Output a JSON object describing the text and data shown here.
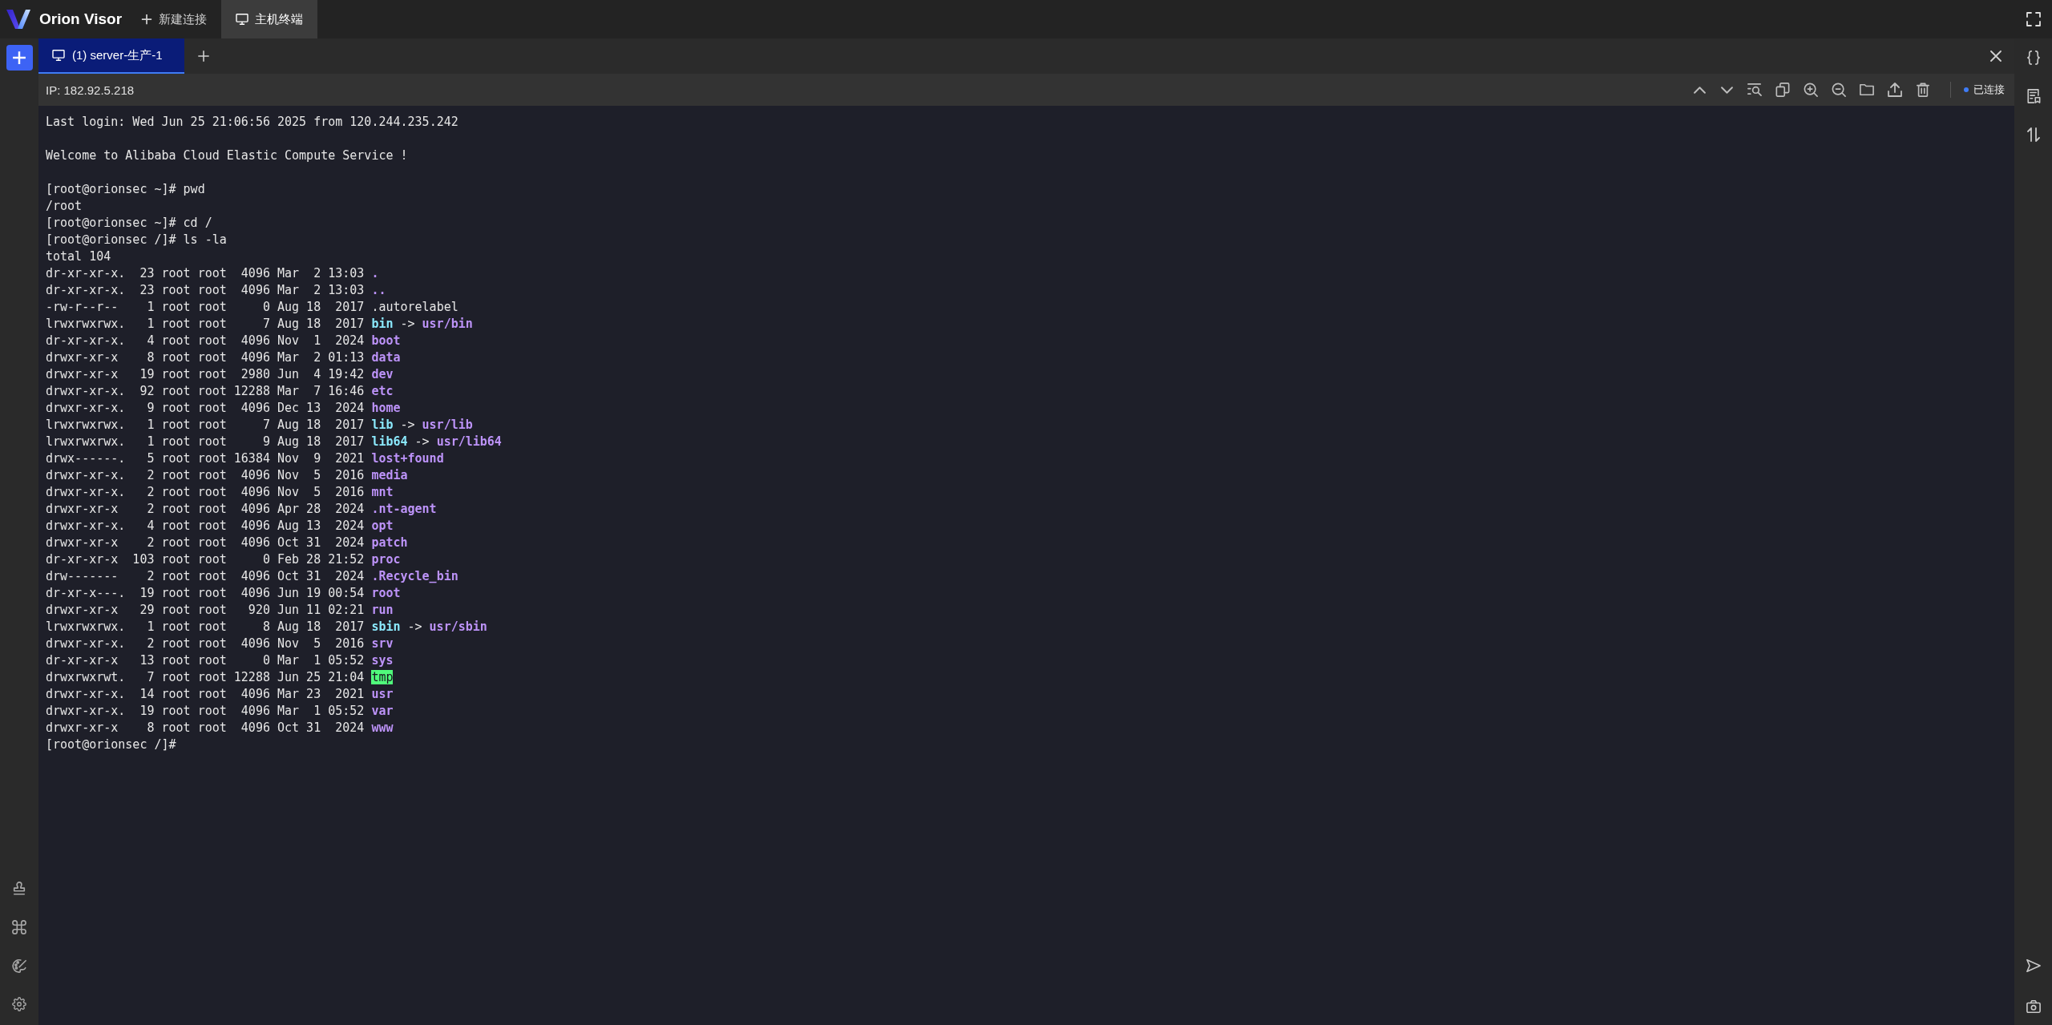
{
  "header": {
    "app_name": "Orion Visor",
    "nav_tabs": [
      {
        "label": "新建连接",
        "kind": "action",
        "selected": false
      },
      {
        "label": "主机终端",
        "kind": "page",
        "selected": true
      }
    ]
  },
  "session_tabs": [
    {
      "label": "(1) server-生产-1",
      "selected": true
    }
  ],
  "host_bar": {
    "ip": "IP: 182.92.5.218",
    "connected": true,
    "status": "已连接"
  },
  "terminal": {
    "lines": [
      {
        "kind": "text",
        "text": "Last login: Wed Jun 25 21:06:56 2025 from 120.244.235.242"
      },
      {
        "kind": "blank"
      },
      {
        "kind": "text",
        "text": "Welcome to Alibaba Cloud Elastic Compute Service !"
      },
      {
        "kind": "blank"
      },
      {
        "kind": "text",
        "text": "[root@orionsec ~]# pwd"
      },
      {
        "kind": "text",
        "text": "/root"
      },
      {
        "kind": "text",
        "text": "[root@orionsec ~]# cd /"
      },
      {
        "kind": "text",
        "text": "[root@orionsec /]# ls -la"
      },
      {
        "kind": "text",
        "text": "total 104"
      },
      {
        "kind": "entry",
        "info": "dr-xr-xr-x.  23 root root  4096 Mar  2 13:03",
        "file": {
          "name": ".",
          "kind": "dir"
        }
      },
      {
        "kind": "entry",
        "info": "dr-xr-xr-x.  23 root root  4096 Mar  2 13:03",
        "file": {
          "name": "..",
          "kind": "dir"
        }
      },
      {
        "kind": "entry",
        "info": "-rw-r--r--    1 root root     0 Aug 18  2017",
        "file": {
          "name": ".autorelabel",
          "kind": "file"
        }
      },
      {
        "kind": "entry",
        "info": "lrwxrwxrwx.   1 root root     7 Aug 18  2017",
        "file": {
          "name": "bin",
          "kind": "link"
        },
        "arrow": "->",
        "target": "usr/bin"
      },
      {
        "kind": "entry",
        "info": "dr-xr-xr-x.   4 root root  4096 Nov  1  2024",
        "file": {
          "name": "boot",
          "kind": "dir"
        }
      },
      {
        "kind": "entry",
        "info": "drwxr-xr-x    8 root root  4096 Mar  2 01:13",
        "file": {
          "name": "data",
          "kind": "dir"
        }
      },
      {
        "kind": "entry",
        "info": "drwxr-xr-x   19 root root  2980 Jun  4 19:42",
        "file": {
          "name": "dev",
          "kind": "dir"
        }
      },
      {
        "kind": "entry",
        "info": "drwxr-xr-x.  92 root root 12288 Mar  7 16:46",
        "file": {
          "name": "etc",
          "kind": "dir"
        }
      },
      {
        "kind": "entry",
        "info": "drwxr-xr-x.   9 root root  4096 Dec 13  2024",
        "file": {
          "name": "home",
          "kind": "dir"
        }
      },
      {
        "kind": "entry",
        "info": "lrwxrwxrwx.   1 root root     7 Aug 18  2017",
        "file": {
          "name": "lib",
          "kind": "link"
        },
        "arrow": "->",
        "target": "usr/lib"
      },
      {
        "kind": "entry",
        "info": "lrwxrwxrwx.   1 root root     9 Aug 18  2017",
        "file": {
          "name": "lib64",
          "kind": "link"
        },
        "arrow": "->",
        "target": "usr/lib64"
      },
      {
        "kind": "entry",
        "info": "drwx------.   5 root root 16384 Nov  9  2021",
        "file": {
          "name": "lost+found",
          "kind": "dir"
        }
      },
      {
        "kind": "entry",
        "info": "drwxr-xr-x.   2 root root  4096 Nov  5  2016",
        "file": {
          "name": "media",
          "kind": "dir"
        }
      },
      {
        "kind": "entry",
        "info": "drwxr-xr-x.   2 root root  4096 Nov  5  2016",
        "file": {
          "name": "mnt",
          "kind": "dir"
        }
      },
      {
        "kind": "entry",
        "info": "drwxr-xr-x    2 root root  4096 Apr 28  2024",
        "file": {
          "name": ".nt-agent",
          "kind": "dir"
        }
      },
      {
        "kind": "entry",
        "info": "drwxr-xr-x.   4 root root  4096 Aug 13  2024",
        "file": {
          "name": "opt",
          "kind": "dir"
        }
      },
      {
        "kind": "entry",
        "info": "drwxr-xr-x    2 root root  4096 Oct 31  2024",
        "file": {
          "name": "patch",
          "kind": "dir"
        }
      },
      {
        "kind": "entry",
        "info": "dr-xr-xr-x  103 root root     0 Feb 28 21:52",
        "file": {
          "name": "proc",
          "kind": "dir"
        }
      },
      {
        "kind": "entry",
        "info": "drw-------    2 root root  4096 Oct 31  2024",
        "file": {
          "name": ".Recycle_bin",
          "kind": "dir"
        }
      },
      {
        "kind": "entry",
        "info": "dr-xr-x---.  19 root root  4096 Jun 19 00:54",
        "file": {
          "name": "root",
          "kind": "dir"
        }
      },
      {
        "kind": "entry",
        "info": "drwxr-xr-x   29 root root   920 Jun 11 02:21",
        "file": {
          "name": "run",
          "kind": "dir"
        }
      },
      {
        "kind": "entry",
        "info": "lrwxrwxrwx.   1 root root     8 Aug 18  2017",
        "file": {
          "name": "sbin",
          "kind": "link"
        },
        "arrow": "->",
        "target": "usr/sbin"
      },
      {
        "kind": "entry",
        "info": "drwxr-xr-x.   2 root root  4096 Nov  5  2016",
        "file": {
          "name": "srv",
          "kind": "dir"
        }
      },
      {
        "kind": "entry",
        "info": "dr-xr-xr-x   13 root root     0 Mar  1 05:52",
        "file": {
          "name": "sys",
          "kind": "dir"
        }
      },
      {
        "kind": "entry",
        "info": "drwxrwxrwt.   7 root root 12288 Jun 25 21:04",
        "file": {
          "name": "tmp",
          "kind": "sticky"
        }
      },
      {
        "kind": "entry",
        "info": "drwxr-xr-x.  14 root root  4096 Mar 23  2021",
        "file": {
          "name": "usr",
          "kind": "dir"
        }
      },
      {
        "kind": "entry",
        "info": "drwxr-xr-x.  19 root root  4096 Mar  1 05:52",
        "file": {
          "name": "var",
          "kind": "dir"
        }
      },
      {
        "kind": "entry",
        "info": "drwxr-xr-x    8 root root  4096 Oct 31  2024",
        "file": {
          "name": "www",
          "kind": "dir"
        }
      },
      {
        "kind": "text",
        "text": "[root@orionsec /]#"
      }
    ]
  }
}
